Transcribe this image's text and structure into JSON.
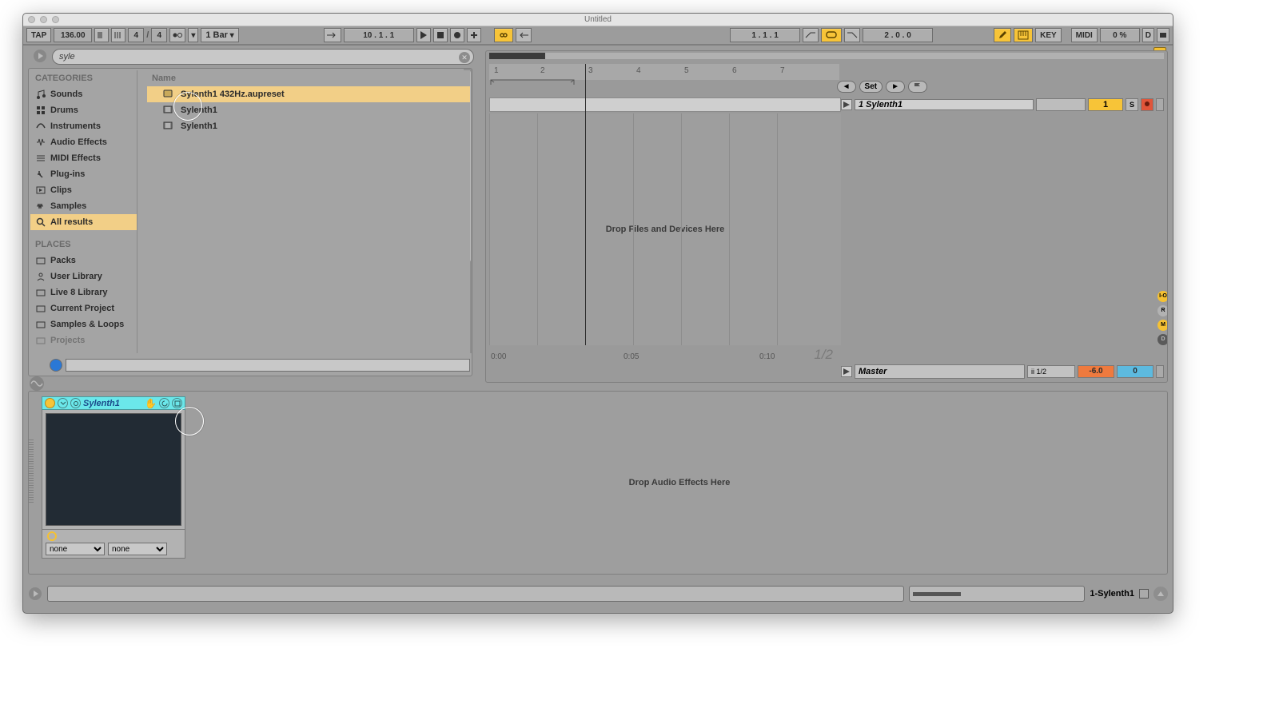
{
  "window_title": "Untitled",
  "toolbar": {
    "tap": "TAP",
    "tempo": "136.00",
    "sig_num": "4",
    "sig_den": "4",
    "quantize": "1 Bar",
    "position": "10 .   1 .   1",
    "loop_pos": "1 .   1 .   1",
    "loop_len": "2 .   0 .   0",
    "key": "KEY",
    "midi": "MIDI",
    "cpu": "0 %",
    "overload": "D"
  },
  "search": {
    "value": "syle"
  },
  "categories_header": "CATEGORIES",
  "categories": [
    {
      "icon": "sounds",
      "label": "Sounds"
    },
    {
      "icon": "drums",
      "label": "Drums"
    },
    {
      "icon": "instruments",
      "label": "Instruments"
    },
    {
      "icon": "audiofx",
      "label": "Audio Effects"
    },
    {
      "icon": "midifx",
      "label": "MIDI Effects"
    },
    {
      "icon": "plugins",
      "label": "Plug-ins"
    },
    {
      "icon": "clips",
      "label": "Clips"
    },
    {
      "icon": "samples",
      "label": "Samples"
    },
    {
      "icon": "search",
      "label": "All results"
    }
  ],
  "places_header": "PLACES",
  "places": [
    {
      "label": "Packs"
    },
    {
      "label": "User Library"
    },
    {
      "label": "Live 8 Library"
    },
    {
      "label": "Current Project"
    },
    {
      "label": "Samples & Loops"
    },
    {
      "label": "Projects"
    }
  ],
  "results_header": "Name",
  "results": [
    {
      "icon": "preset",
      "label": "Sylenth1 432Hz.aupreset",
      "sel": true
    },
    {
      "icon": "plugin",
      "label": "Sylenth1",
      "sel": false
    },
    {
      "icon": "plugin",
      "label": "Sylenth1",
      "sel": false
    }
  ],
  "drop_text": "Drop Files and Devices Here",
  "drop_effects_text": "Drop Audio Effects Here",
  "ruler_bars": [
    "1",
    "2",
    "3",
    "4",
    "5",
    "6",
    "7"
  ],
  "set_label": "Set",
  "track": {
    "name": "1 Sylenth1",
    "num": "1",
    "solo": "S"
  },
  "half": "1/2",
  "master": {
    "name": "Master",
    "q": "ii 1/2",
    "vol": "-6.0",
    "pan": "0"
  },
  "time_labels": [
    "0:00",
    "0:05",
    "0:10"
  ],
  "device": {
    "name": "Sylenth1",
    "sel_a": "none",
    "sel_b": "none"
  },
  "status_track": "1-Sylenth1",
  "side_buttons": [
    "I-O",
    "R",
    "M",
    "D"
  ]
}
